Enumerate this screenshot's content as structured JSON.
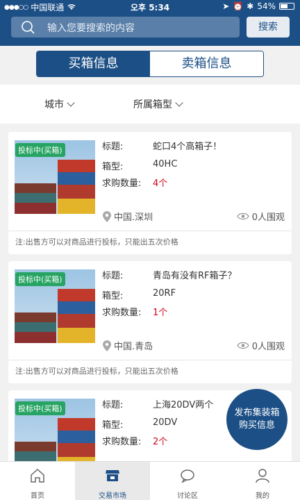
{
  "status_bar": {
    "carrier": "中国联通",
    "time": "오후 5:34",
    "battery": "54%"
  },
  "search": {
    "placeholder": "输入您要搜索的内容",
    "button": "搜索"
  },
  "tabs": [
    {
      "label": "买箱信息",
      "active": true
    },
    {
      "label": "卖箱信息",
      "active": false
    }
  ],
  "filters": {
    "city": "城市",
    "box_type": "所属箱型"
  },
  "labels": {
    "title": "标题:",
    "box": "箱型:",
    "qty": "求购数量:"
  },
  "listings": [
    {
      "badge": "投标中(买箱)",
      "title": "蛇口4个高箱子！",
      "box_type": "40HC",
      "quantity": "4个",
      "location": "中国.深圳",
      "views": "0人围观",
      "note": "注:出售方可以对商品进行投标，只能出五次价格"
    },
    {
      "badge": "投标中(买箱)",
      "title": "青岛有没有RF箱子？",
      "box_type": "20RF",
      "quantity": "1个",
      "location": "中国.青岛",
      "views": "0人围观",
      "note": "注:出售方可以对商品进行投标，只能出五次价格"
    },
    {
      "badge": "投标中(买箱)",
      "title": "上海20DV两个",
      "box_type": "20DV",
      "quantity": "2个"
    }
  ],
  "fab": {
    "line1": "发布集装箱",
    "line2": "购买信息"
  },
  "bottom_nav": [
    {
      "label": "首页",
      "icon": "home-icon",
      "active": false
    },
    {
      "label": "交易市场",
      "icon": "shop-icon",
      "active": true
    },
    {
      "label": "讨论区",
      "icon": "chat-icon",
      "active": false
    },
    {
      "label": "我的",
      "icon": "user-icon",
      "active": false
    }
  ],
  "colors": {
    "primary": "#1c4f86",
    "badge": "#27a463",
    "quantity": "#d0021b"
  }
}
